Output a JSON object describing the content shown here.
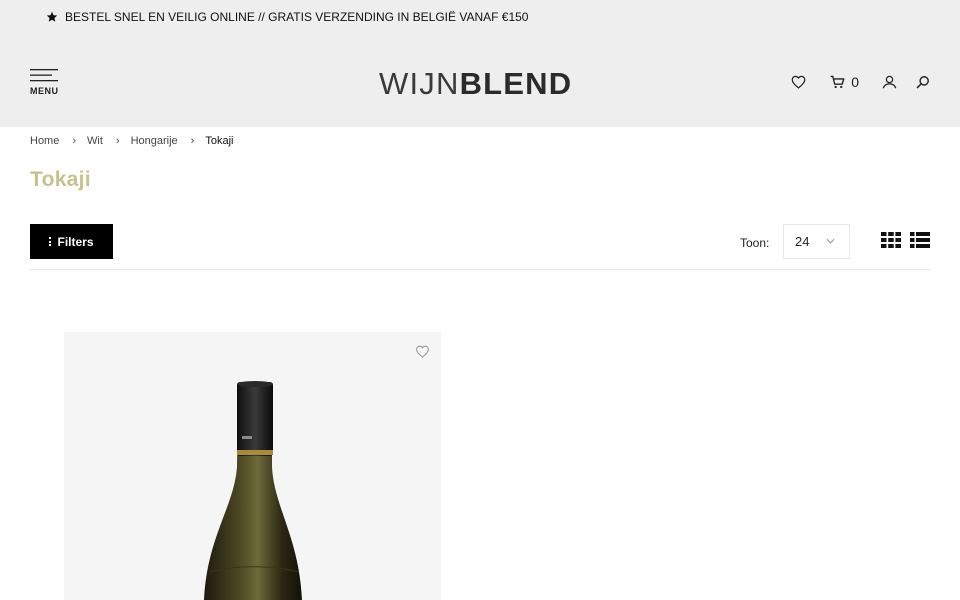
{
  "promo": {
    "text": "BESTEL SNEL EN VEILIG ONLINE // GRATIS VERZENDING IN BELGIË VANAF €150"
  },
  "header": {
    "menu_label": "MENU",
    "logo_part1": "WIJN",
    "logo_part2": "BLEND",
    "cart_count": "0",
    "icons": [
      "heart-icon",
      "cart-icon",
      "user-icon",
      "search-icon"
    ]
  },
  "breadcrumb": {
    "items": [
      "Home",
      "Wit",
      "Hongarije",
      "Tokaji"
    ],
    "separator": "›"
  },
  "page": {
    "title": "Tokaji"
  },
  "toolbar": {
    "filters_label": "Filters",
    "show_label": "Toon:",
    "per_page_value": "24"
  },
  "colors": {
    "header_bg": "#eeeeee",
    "title_accent": "#c7c28a",
    "button_bg": "#000000",
    "card_bg": "#f5f5f5"
  }
}
